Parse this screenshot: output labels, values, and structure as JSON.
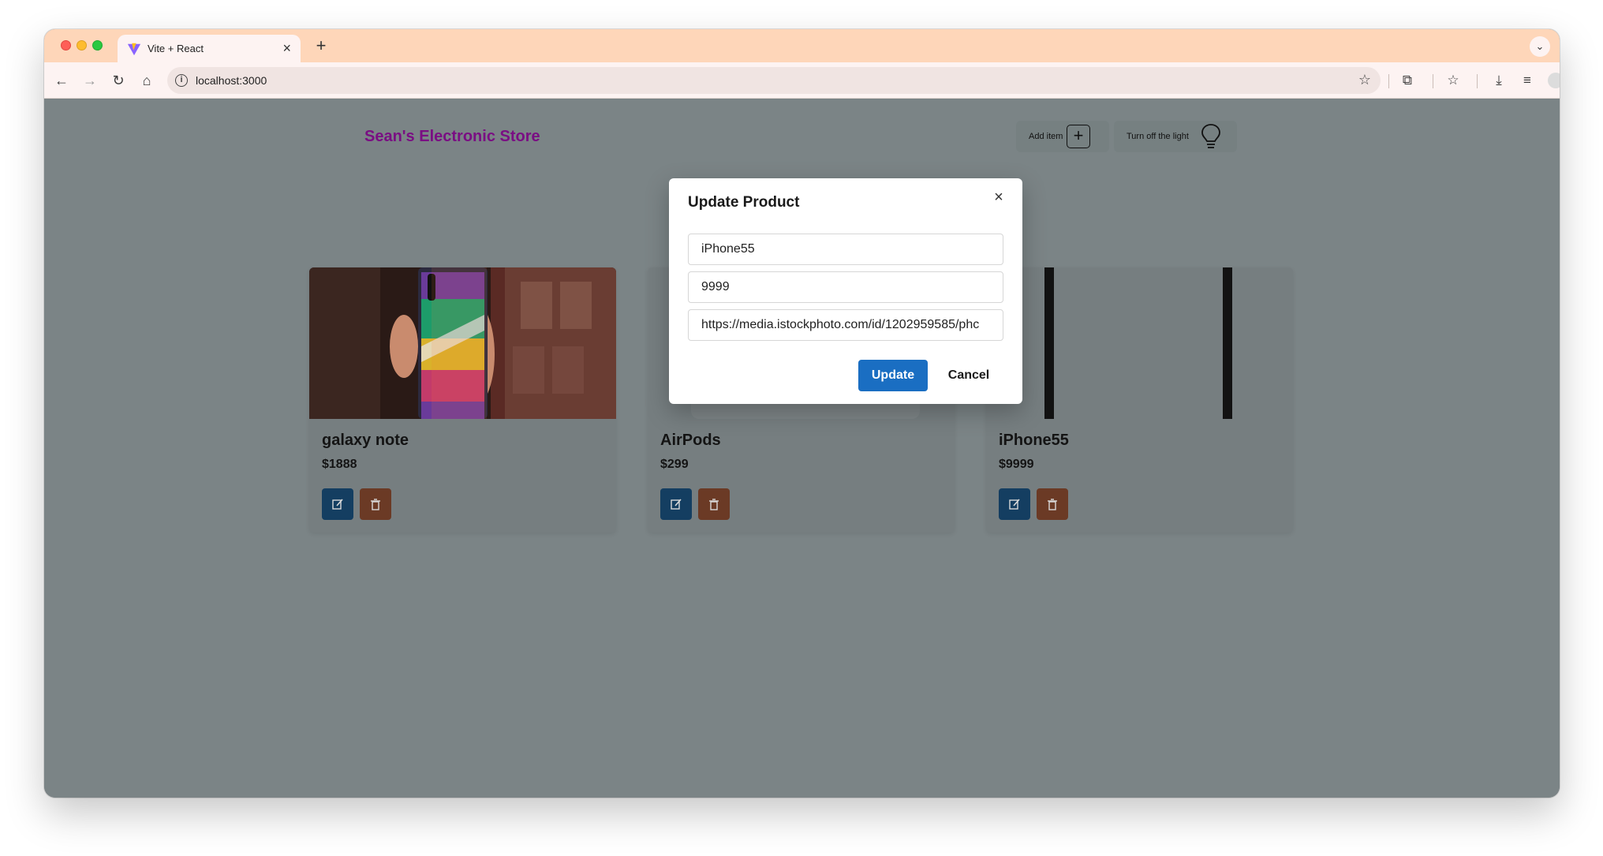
{
  "browser": {
    "tab_title": "Vite + React",
    "url": "localhost:3000",
    "tab_close": "×",
    "new_tab": "+",
    "colors": {
      "tab_bar": "#fed6b9",
      "toolbar": "#fdf3f2"
    }
  },
  "header": {
    "store_title": "Sean's Electronic Store",
    "add_item_label": "Add item",
    "light_toggle_label": "Turn off the light",
    "title_color": "#7a0e83"
  },
  "products": [
    {
      "name": "galaxy note",
      "price": "$1888",
      "image_desc": "colorful phone held in hand"
    },
    {
      "name": "AirPods",
      "price": "$299",
      "image_desc": "white AirPods case"
    },
    {
      "name": "iPhone55",
      "price": "$9999",
      "image_desc": "black phone edges"
    }
  ],
  "modal": {
    "title": "Update Product",
    "name_value": "iPhone55",
    "price_value": "9999",
    "url_value": "https://media.istockphoto.com/id/1202959585/phc",
    "update_label": "Update",
    "cancel_label": "Cancel",
    "close_icon": "×",
    "accent": "#1a6ec2"
  },
  "icons": {
    "edit": "edit-icon",
    "delete": "trash-icon"
  }
}
